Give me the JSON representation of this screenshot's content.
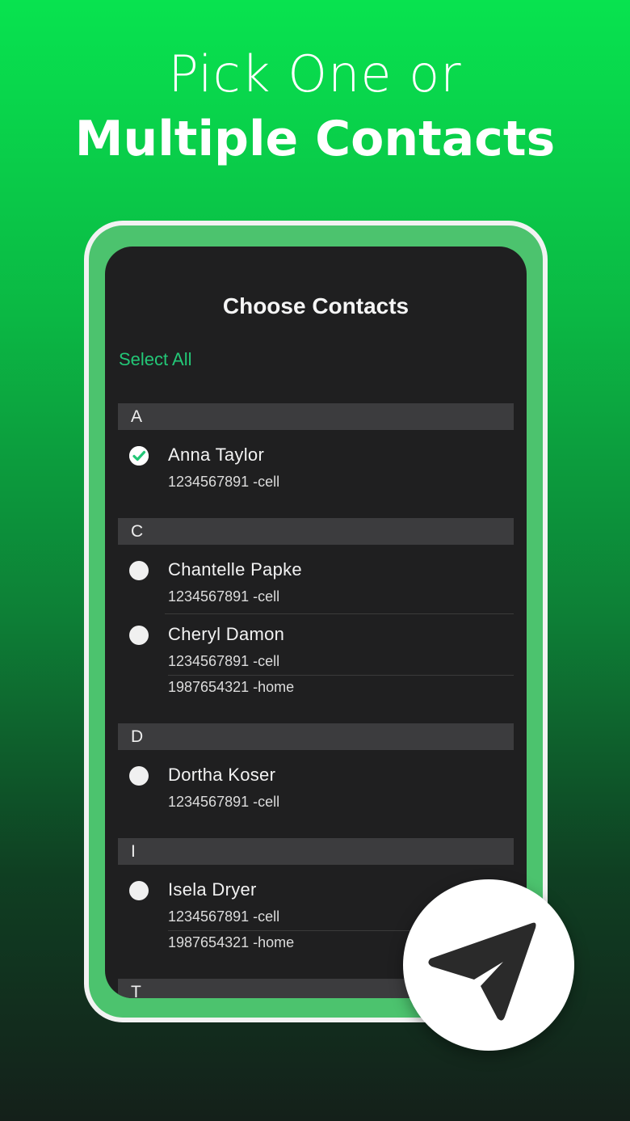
{
  "headline": {
    "line1": "Pick One or",
    "line2": "Multiple Contacts"
  },
  "screen": {
    "title": "Choose Contacts",
    "select_all": "Select All"
  },
  "sections": [
    {
      "letter": "A",
      "contacts": [
        {
          "name": "Anna Taylor",
          "checked": true,
          "phones": [
            "1234567891 -cell"
          ]
        }
      ]
    },
    {
      "letter": "C",
      "contacts": [
        {
          "name": "Chantelle Papke",
          "checked": false,
          "phones": [
            "1234567891 -cell"
          ]
        },
        {
          "name": "Cheryl Damon",
          "checked": false,
          "phones": [
            "1234567891 -cell",
            "1987654321 -home"
          ]
        }
      ]
    },
    {
      "letter": "D",
      "contacts": [
        {
          "name": "Dortha Koser",
          "checked": false,
          "phones": [
            "1234567891 -cell"
          ]
        }
      ]
    },
    {
      "letter": "I",
      "contacts": [
        {
          "name": "Isela Dryer",
          "checked": false,
          "phones": [
            "1234567891 -cell",
            "1987654321 -home"
          ]
        }
      ]
    },
    {
      "letter": "T",
      "contacts": []
    }
  ],
  "colors": {
    "accent": "#23c777",
    "check": "#23c777",
    "screen_bg": "#1f1f20",
    "section_bg": "#3c3c3e"
  },
  "icons": {
    "send": "send-icon",
    "check": "check-icon"
  }
}
